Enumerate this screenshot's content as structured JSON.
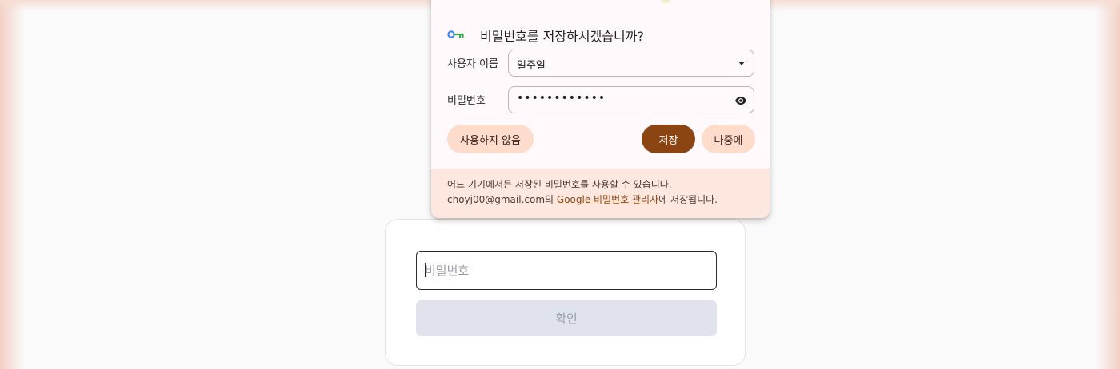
{
  "save_password_popup": {
    "title": "비밀번호를 저장하시겠습니까?",
    "username_label": "사용자 이름",
    "username_value": "일주일",
    "password_label": "비밀번호",
    "password_masked": "••••••••••••",
    "buttons": {
      "never": "사용하지 않음",
      "save": "저장",
      "later": "나중에"
    },
    "footer": {
      "line1": "어느 기기에서든 저장된 비밀번호를 사용할 수 있습니다.",
      "line2_prefix": "choyj00@gmail.com의 ",
      "line2_link": "Google 비밀번호 관리자",
      "line2_suffix": "에 저장됩니다."
    }
  },
  "login_form": {
    "password_placeholder": "비밀번호",
    "confirm_label": "확인"
  },
  "colors": {
    "accent": "#8b4513",
    "pill_light": "#fddccc",
    "footer_bg": "#fde7de",
    "disabled_button": "#e0e3ec"
  },
  "icons": {
    "key": "key-icon",
    "dropdown": "chevron-down-icon",
    "eye": "eye-icon"
  }
}
